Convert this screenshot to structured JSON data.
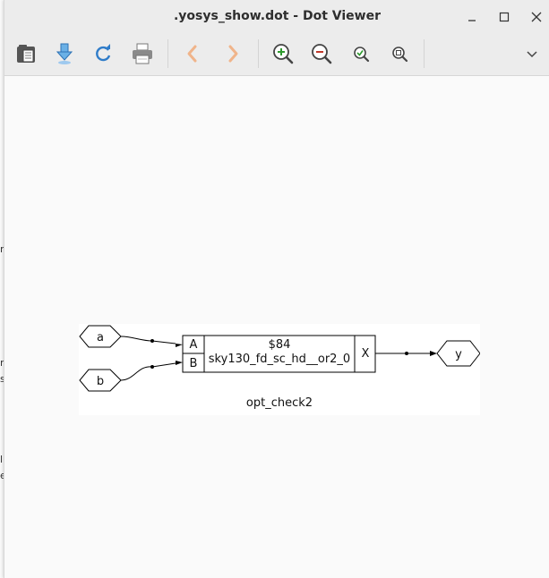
{
  "window": {
    "title": ".yosys_show.dot - Dot Viewer",
    "controls": {
      "minimize": "–",
      "maximize": "□",
      "close": "✕"
    }
  },
  "toolbar": {
    "icons": [
      "open-icon",
      "save-download-icon",
      "reload-icon",
      "print-icon",
      "back-icon",
      "forward-icon",
      "zoom-in-icon",
      "zoom-out-icon",
      "zoom-fit-icon",
      "zoom-100-icon",
      "menu-chevron-icon"
    ]
  },
  "background_fragments": [
    "n",
    "n",
    "s",
    "l",
    "e"
  ],
  "graph": {
    "inputs": [
      "a",
      "b"
    ],
    "cell": {
      "id": "$84",
      "type": "sky130_fd_sc_hd__or2_0",
      "in_ports": [
        "A",
        "B"
      ],
      "out_port": "X"
    },
    "output": "y",
    "module": "opt_check2"
  }
}
